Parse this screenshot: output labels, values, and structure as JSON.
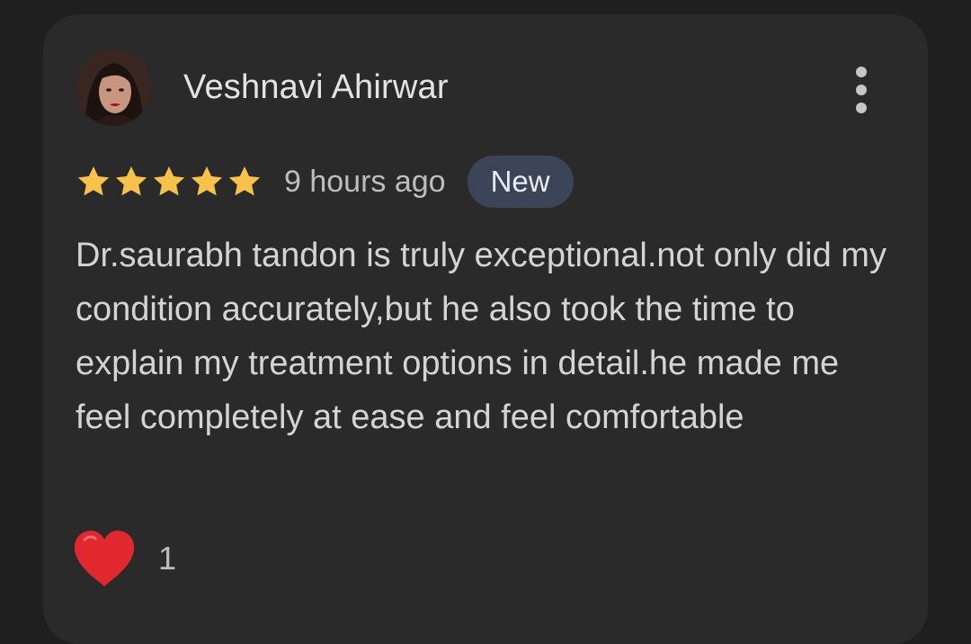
{
  "review": {
    "author_name": "Veshnavi Ahirwar",
    "avatar_icon": "user-avatar-photo",
    "menu_icon": "more-vert-icon",
    "rating": 5,
    "rating_max": 5,
    "star_color": "#f8c24a",
    "time_ago": "9 hours ago",
    "badge_label": "New",
    "text": "Dr.saurabh tandon is truly exceptional.not only did my condition accurately,but he also took the time to explain my treatment options in detail.he made me feel completely at ease and feel comfortable",
    "reaction": {
      "icon": "heart-icon",
      "count": "1",
      "color": "#e0282e"
    }
  }
}
